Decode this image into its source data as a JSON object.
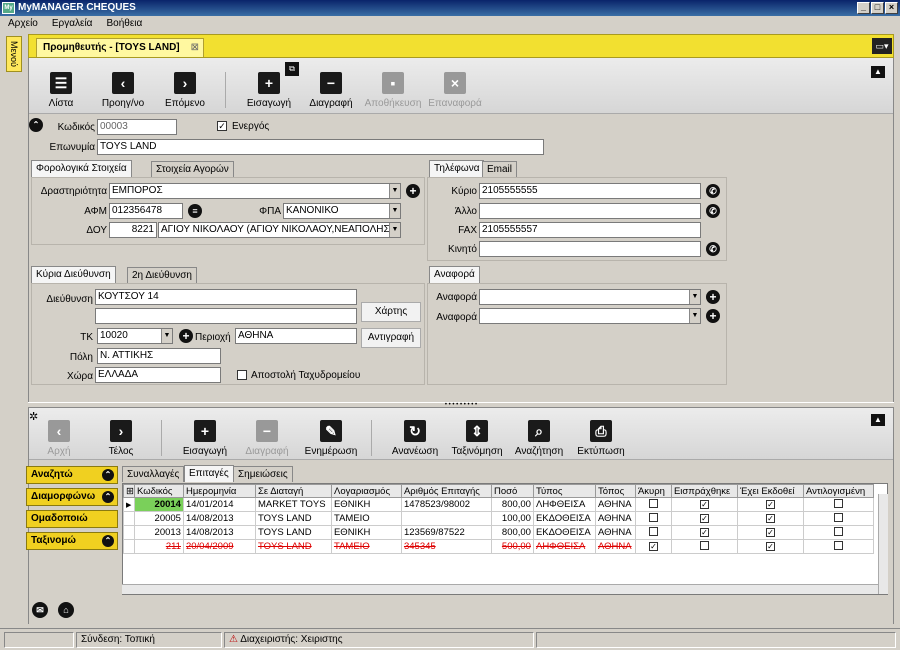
{
  "window": {
    "title": "MyMANAGER CHEQUES",
    "logo": "My"
  },
  "menu": [
    "Αρχείο",
    "Εργαλεία",
    "Βοήθεια"
  ],
  "side_tab": "Μενού",
  "doc_tab": {
    "title": "Προμηθευτής - [TOYS LAND]",
    "close": "⊠"
  },
  "toolbar": {
    "list": "Λίστα",
    "prev": "Προηγ/νο",
    "next": "Επόμενο",
    "insert": "Εισαγωγή",
    "delete": "Διαγραφή",
    "save": "Αποθήκευση",
    "revert": "Επαναφορά"
  },
  "header": {
    "code_label": "Κωδικός",
    "code": "00003",
    "active_label": "Ενεργός",
    "name_label": "Επωνυμία",
    "name": "TOYS LAND"
  },
  "tax_tabs": [
    "Φορολογικά Στοιχεία",
    "Στοιχεία Αγορών"
  ],
  "tax": {
    "activity_label": "Δραστηριότητα",
    "activity": "ΕΜΠΟΡΟΣ",
    "afm_label": "ΑΦΜ",
    "afm": "012356478",
    "fpa_label": "ΦΠΑ",
    "fpa": "ΚΑΝΟΝΙΚΟ",
    "doy_label": "ΔΟΥ",
    "doy_code": "8221",
    "doy": "ΑΓΙΟΥ ΝΙΚΟΛΑΟΥ (ΑΓΙΟΥ ΝΙΚΟΛΑΟΥ,ΝΕΑΠΟΛΗΣ,Ι"
  },
  "phone_tabs": [
    "Τηλέφωνα",
    "Email"
  ],
  "phones": {
    "main_label": "Κύριο",
    "main": "2105555555",
    "other_label": "Άλλο",
    "other": "",
    "fax_label": "FAX",
    "fax": "2105555557",
    "mobile_label": "Κινητό",
    "mobile": ""
  },
  "address_tabs": [
    "Κύρια Διεύθυνση",
    "2η Διεύθυνση"
  ],
  "address": {
    "street_label": "Διεύθυνση",
    "street": "ΚΟΥΤΣΟΥ 14",
    "street2": "",
    "tk_label": "ΤΚ",
    "tk": "10020",
    "area_label": "Περιοχή",
    "area": "ΑΘΗΝΑ",
    "city_label": "Πόλη",
    "city": "Ν. ΑΤΤΙΚΗΣ",
    "country_label": "Χώρα",
    "country": "ΕΛΛΑΔΑ",
    "mail_label": "Αποστολή Ταχυδρομείου",
    "map_btn": "Χάρτης",
    "copy_btn": "Αντιγραφή"
  },
  "ref_tabs": [
    "Αναφορά"
  ],
  "refs": {
    "ref1_label": "Αναφορά",
    "ref2_label": "Αναφορά"
  },
  "lower_toolbar": {
    "first": "Αρχή",
    "last": "Τέλος",
    "insert": "Εισαγωγή",
    "delete": "Διαγραφή",
    "update": "Ενημέρωση",
    "refresh": "Ανανέωση",
    "sort": "Ταξινόμηση",
    "search": "Αναζήτηση",
    "print": "Εκτύπωση"
  },
  "nav_buttons": [
    "Αναζητώ",
    "Διαμορφώνω",
    "Ομαδοποιώ",
    "Ταξινομώ"
  ],
  "grid_tabs": [
    "Συναλλαγές",
    "Επιταγές",
    "Σημειώσεις"
  ],
  "grid": {
    "columns": [
      "Κωδικός",
      "Ημερομηνία",
      "Σε Διαταγή",
      "Λογαριασμός",
      "Αριθμός Επιταγής",
      "Ποσό",
      "Τύπος",
      "Τόπος",
      "Άκυρη",
      "Εισπράχθηκε",
      "Έχει Εκδοθεί",
      "Αντιλογισμένη"
    ],
    "rows": [
      {
        "code": "20014",
        "date": "14/01/2014",
        "order": "MARKET TOYS",
        "account": "ΕΘΝΙΚΗ",
        "cheque": "1478523/98002",
        "amount": "800,00",
        "type": "ΛΗΦΘΕΙΣΑ",
        "place": "ΑΘΗΝΑ",
        "void": "",
        "collected": "✓",
        "issued": "✓",
        "reversed": "",
        "cancelled": false
      },
      {
        "code": "20005",
        "date": "14/08/2013",
        "order": "TOYS LAND",
        "account": "ΤΑΜΕΙΟ",
        "cheque": "",
        "amount": "100,00",
        "type": "ΕΚΔΟΘΕΙΣΑ",
        "place": "ΑΘΗΝΑ",
        "void": "",
        "collected": "✓",
        "issued": "✓",
        "reversed": "",
        "cancelled": false
      },
      {
        "code": "20013",
        "date": "14/08/2013",
        "order": "TOYS LAND",
        "account": "ΕΘΝΙΚΗ",
        "cheque": "123569/87522",
        "amount": "800,00",
        "type": "ΕΚΔΟΘΕΙΣΑ",
        "place": "ΑΘΗΝΑ",
        "void": "",
        "collected": "✓",
        "issued": "✓",
        "reversed": "",
        "cancelled": false
      },
      {
        "code": "211",
        "date": "20/04/2009",
        "order": "TOYS LAND",
        "account": "ΤΑΜΕΙΟ",
        "cheque": "345345",
        "amount": "500,00",
        "type": "ΛΗΦΘΕΙΣΑ",
        "place": "ΑΘΗΝΑ",
        "void": "✓",
        "collected": "",
        "issued": "✓",
        "reversed": "",
        "cancelled": true
      }
    ]
  },
  "status": {
    "connection": "Σύνδεση: Τοπική",
    "user": "Διαχειριστής: Χειριστης"
  },
  "colors": {
    "accent": "#f2e030",
    "cancelled": "#dd0000"
  }
}
